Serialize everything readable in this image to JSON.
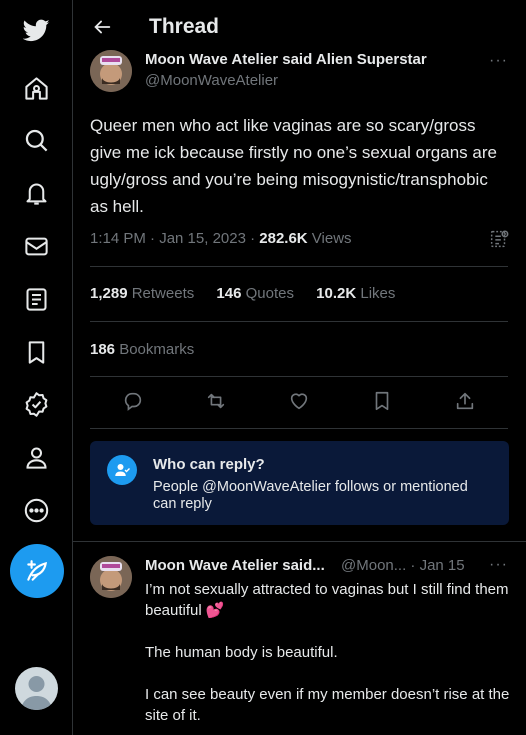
{
  "header": {
    "title": "Thread"
  },
  "tweet": {
    "author_name": "Moon Wave Atelier said Alien Superstar",
    "author_handle": "@MoonWaveAtelier",
    "text": "Queer men who act like vaginas are so scary/gross give me ick because firstly no one’s sexual organs are ugly/gross and you’re being misogynistic/transphobic as hell.",
    "time": "1:14 PM · Jan 15, 2023 · ",
    "views_count": "282.6K",
    "views_label": " Views",
    "retweets_count": "1,289",
    "retweets_label": " Retweets",
    "quotes_count": "146",
    "quotes_label": " Quotes",
    "likes_count": "10.2K",
    "likes_label": " Likes",
    "bookmarks_count": "186",
    "bookmarks_label": " Bookmarks"
  },
  "who_can_reply": {
    "title": "Who can reply?",
    "description": "People @MoonWaveAtelier follows or mentioned can reply"
  },
  "reply": {
    "author_name": "Moon Wave Atelier said...",
    "handle_date": "@Moon... · Jan 15",
    "line1": "I’m not sexually attracted to vaginas but I still find them beautiful",
    "emoji": "💕",
    "line2": "The human body is beautiful.",
    "line3": "I can see beauty even if my member doesn’t rise at the site of it."
  },
  "more_label": "···",
  "colors": {
    "accent": "#1d9bf0",
    "background": "#000000",
    "muted": "#71767b",
    "reply_box": "#0a1939"
  }
}
